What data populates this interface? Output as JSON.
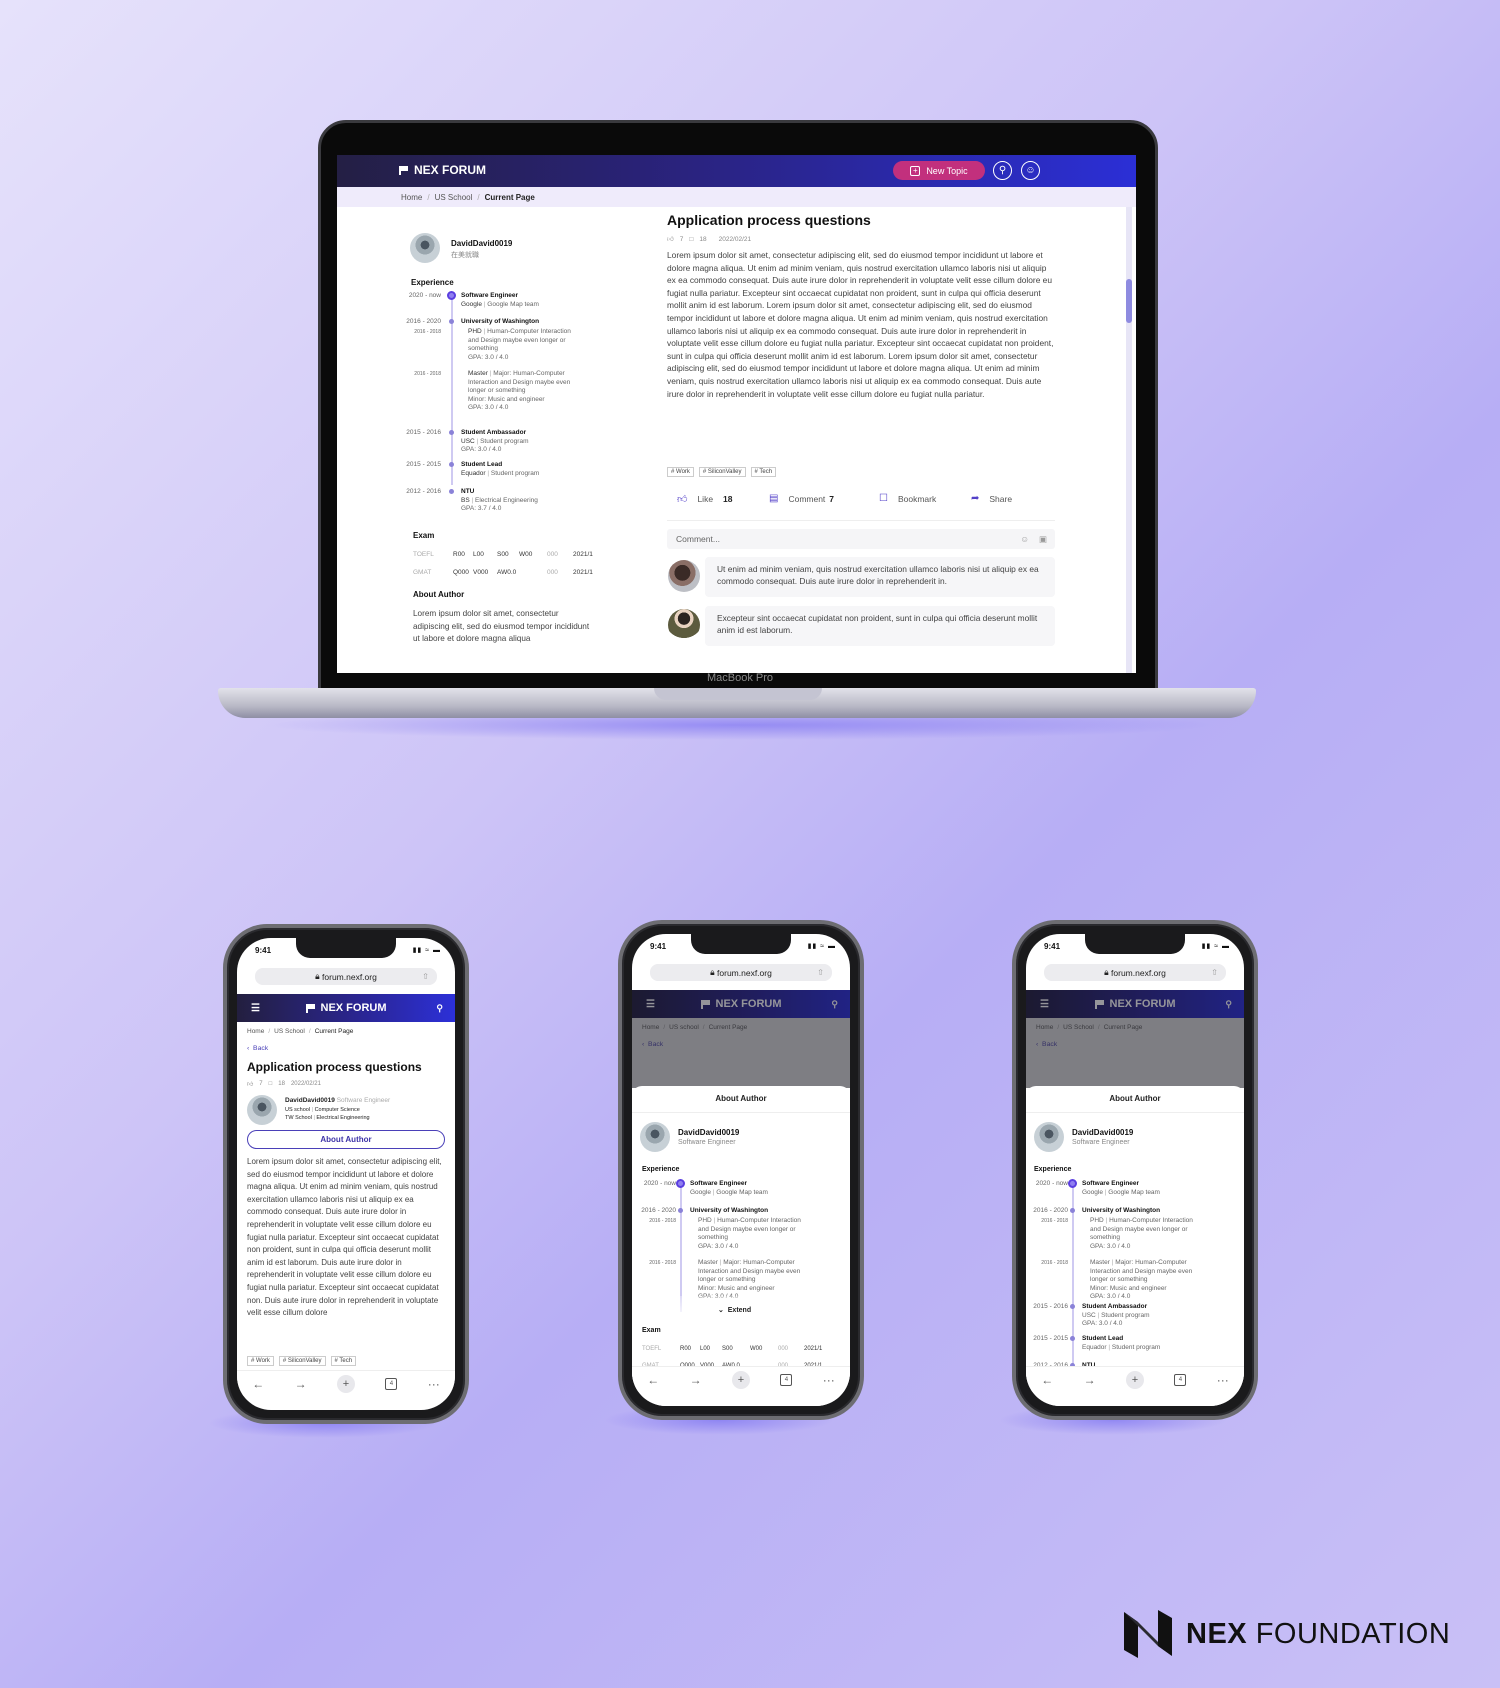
{
  "desktop": {
    "device_label": "MacBook Pro",
    "header": {
      "logo": "NEX FORUM",
      "new_topic": "New Topic",
      "search_icon": "search-icon",
      "user_icon": "user-icon"
    },
    "breadcrumb": [
      "Home",
      "US School",
      "Current Page"
    ],
    "author": {
      "name": "DavidDavid0019",
      "subtitle": "在美就職"
    },
    "experience": {
      "heading": "Experience",
      "items": [
        {
          "date": "2020 - now",
          "title": "Software Engineer",
          "line1_a": "Google",
          "line1_b": "Google Map team"
        },
        {
          "date": "2016 - 2020",
          "title": "University of Washington"
        },
        {
          "date": "2016 - 2018",
          "sub": true,
          "line1_a": "PHD",
          "line1_b": "Human-Computer Interaction",
          "line2": "and Design maybe even longer or",
          "line3": "something",
          "line4": "GPA: 3.0 / 4.0"
        },
        {
          "date": "2016 - 2018",
          "sub": true,
          "line1_a": "Master",
          "line1_b": "Major: Human-Computer",
          "line2": "Interaction and Design maybe even",
          "line3": "longer or something",
          "line4": "Minor: Music and engineer",
          "line5": "GPA: 3.0 / 4.0"
        },
        {
          "date": "2015 - 2016",
          "title": "Student Ambassador",
          "line1_a": "USC",
          "line1_b": "Student program",
          "line2": "GPA: 3.0 / 4.0"
        },
        {
          "date": "2015 - 2015",
          "title": "Student Lead",
          "line1_a": "Equador",
          "line1_b": "Student program"
        },
        {
          "date": "2012 - 2016",
          "title": "NTU",
          "line1_a": "BS",
          "line1_b": "Electrical Engineering",
          "line2": "GPA: 3.7 / 4.0"
        }
      ]
    },
    "exam": {
      "heading": "Exam",
      "rows": [
        {
          "name": "TOEFL",
          "a": "R00",
          "b": "L00",
          "c": "S00",
          "d": "W00",
          "total": "000",
          "date": "2021/1"
        },
        {
          "name": "GMAT",
          "a": "Q000",
          "b": "V000",
          "c": "AW0.0",
          "d": "",
          "total": "000",
          "date": "2021/1"
        }
      ]
    },
    "about": {
      "heading": "About Author",
      "text": "Lorem ipsum dolor sit amet, consectetur adipiscing elit, sed do eiusmod tempor incididunt ut labore et dolore magna aliqua"
    },
    "post": {
      "title": "Application process questions",
      "likes": "7",
      "comments": "18",
      "date": "2022/02/21",
      "body": "Lorem ipsum dolor sit amet, consectetur adipiscing elit, sed do eiusmod tempor incididunt ut labore et dolore magna aliqua. Ut enim ad minim veniam, quis nostrud exercitation ullamco laboris nisi ut aliquip ex ea commodo consequat. Duis aute irure dolor in reprehenderit in voluptate velit esse cillum dolore eu fugiat nulla pariatur. Excepteur sint occaecat cupidatat non proident, sunt in culpa qui officia deserunt mollit anim id est laborum. Lorem ipsum dolor sit amet, consectetur adipiscing elit, sed do eiusmod tempor incididunt ut labore et dolore magna aliqua. Ut enim ad minim veniam, quis nostrud exercitation ullamco laboris nisi ut aliquip ex ea commodo consequat. Duis aute irure dolor in reprehenderit in voluptate velit esse cillum dolore eu fugiat nulla pariatur. Excepteur sint occaecat cupidatat non proident, sunt in culpa qui officia deserunt mollit anim id est laborum. Lorem ipsum dolor sit amet, consectetur adipiscing elit, sed do eiusmod tempor incididunt ut labore et dolore magna aliqua. Ut enim ad minim veniam, quis nostrud exercitation ullamco laboris nisi ut aliquip ex ea commodo consequat. Duis aute irure dolor in reprehenderit in voluptate velit esse cillum dolore eu fugiat nulla pariatur.",
      "tags": [
        "Work",
        "SiliconValley",
        "Tech"
      ],
      "actions": {
        "like": "Like",
        "like_count": "18",
        "comment": "Comment",
        "comment_count": "7",
        "bookmark": "Bookmark",
        "share": "Share"
      },
      "comment_placeholder": "Comment...",
      "comment_list": [
        "Ut enim ad minim veniam, quis nostrud exercitation ullamco laboris nisi ut aliquip ex ea commodo consequat. Duis aute irure dolor in reprehenderit in.",
        "Excepteur sint occaecat cupidatat non proident, sunt in culpa qui officia deserunt mollit anim id est laborum."
      ]
    }
  },
  "mobile": {
    "time": "9:41",
    "url": "forum.nexf.org",
    "logo": "NEX FORUM",
    "back": "Back",
    "phone1": {
      "breadcrumb": [
        "Home",
        "US School",
        "Current Page"
      ],
      "title": "Application process questions",
      "likes": "7",
      "comments": "18",
      "date": "2022/02/21",
      "author_name": "DavidDavid0019",
      "author_role": "Software Engineer",
      "school1_a": "US school",
      "school1_b": "Computer Science",
      "school2_a": "TW School",
      "school2_b": "Electrical Engineering",
      "about_button": "About Author",
      "body": "Lorem ipsum dolor sit amet, consectetur adipiscing elit, sed do eiusmod tempor incididunt ut labore et dolore magna aliqua. Ut enim ad minim veniam, quis nostrud exercitation ullamco laboris nisi ut aliquip ex ea commodo consequat. Duis aute irure dolor in reprehenderit in voluptate velit esse cillum dolore eu fugiat nulla pariatur. Excepteur sint occaecat cupidatat non proident, sunt in culpa qui officia deserunt mollit anim id est laborum. Duis aute irure dolor in reprehenderit in voluptate velit esse cillum dolore eu fugiat nulla pariatur. Excepteur sint occaecat cupidatat non. Duis aute irure dolor in reprehenderit in voluptate velit esse cillum dolore",
      "tags": [
        "Work",
        "SiliconValley",
        "Tech"
      ]
    },
    "phone2": {
      "breadcrumb": [
        "Home",
        "US school",
        "Current Page"
      ],
      "sheet_title": "About Author",
      "author_name": "DavidDavid0019",
      "author_role": "Software Engineer",
      "extend": "Extend"
    },
    "phone3": {
      "breadcrumb": [
        "Home",
        "US School",
        "Current Page"
      ],
      "sheet_title": "About Author",
      "author_name": "DavidDavid0019",
      "author_role": "Software Engineer"
    },
    "tab_count": "4"
  },
  "brand": {
    "bold": "NEX",
    "rest": " FOUNDATION"
  },
  "colors": {
    "accent": "#5340c8",
    "new_topic": "#c2307d",
    "header_start": "#241f44",
    "header_end": "#2b2fd6"
  }
}
